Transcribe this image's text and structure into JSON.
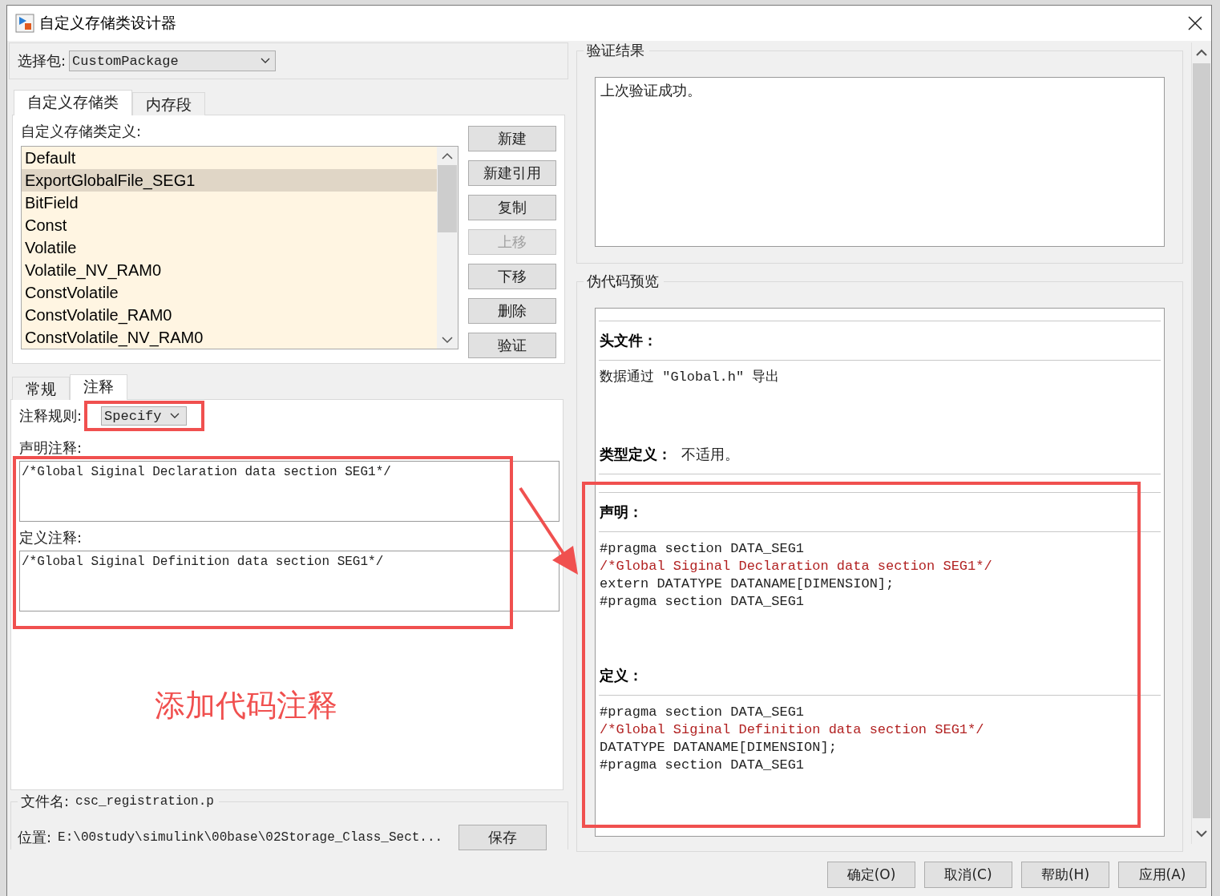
{
  "window": {
    "title": "自定义存储类设计器"
  },
  "package": {
    "label": "选择包:",
    "value": "CustomPackage"
  },
  "main_tabs": [
    {
      "label": "自定义存储类",
      "selected": true
    },
    {
      "label": "内存段",
      "selected": false
    }
  ],
  "definitions": {
    "label": "自定义存储类定义:",
    "items": [
      {
        "label": "Default",
        "selected": false
      },
      {
        "label": "ExportGlobalFile_SEG1",
        "selected": true
      },
      {
        "label": "BitField",
        "selected": false
      },
      {
        "label": "Const",
        "selected": false
      },
      {
        "label": "Volatile",
        "selected": false
      },
      {
        "label": "Volatile_NV_RAM0",
        "selected": false
      },
      {
        "label": "ConstVolatile",
        "selected": false
      },
      {
        "label": "ConstVolatile_RAM0",
        "selected": false
      },
      {
        "label": "ConstVolatile_NV_RAM0",
        "selected": false
      }
    ]
  },
  "list_buttons": [
    {
      "label": "新建",
      "disabled": false
    },
    {
      "label": "新建引用",
      "disabled": false
    },
    {
      "label": "复制",
      "disabled": false
    },
    {
      "label": "上移",
      "disabled": true
    },
    {
      "label": "下移",
      "disabled": false
    },
    {
      "label": "删除",
      "disabled": false
    },
    {
      "label": "验证",
      "disabled": false
    }
  ],
  "detail_tabs": [
    {
      "label": "常规",
      "selected": false
    },
    {
      "label": "注释",
      "selected": true
    }
  ],
  "comment_rule": {
    "label": "注释规则:",
    "value": "Specify"
  },
  "declaration_comment": {
    "label": "声明注释:",
    "value": "/*Global Siginal Declaration data section SEG1*/"
  },
  "definition_comment": {
    "label": "定义注释:",
    "value": "/*Global Siginal Definition data section SEG1*/"
  },
  "file": {
    "label": "文件名:",
    "value": "csc_registration.p"
  },
  "location": {
    "label": "位置:",
    "value": "E:\\00study\\simulink\\00base\\02Storage_Class_Sect..."
  },
  "save_button": "保存",
  "validation": {
    "title": "验证结果",
    "message": "上次验证成功。"
  },
  "preview": {
    "title": "伪代码预览",
    "sections": [
      {
        "heading": "头文件：",
        "lines": [
          {
            "kind": "code",
            "text": "数据通过 \"Global.h\" 导出"
          }
        ]
      },
      {
        "heading": "类型定义：",
        "note": "不适用。"
      },
      {
        "heading": "声明：",
        "lines": [
          {
            "kind": "code",
            "text": "#pragma section DATA_SEG1"
          },
          {
            "kind": "comment",
            "text": "/*Global Siginal Declaration data section SEG1*/"
          },
          {
            "kind": "code",
            "text": "extern DATATYPE DATANAME[DIMENSION];"
          },
          {
            "kind": "code",
            "text": "#pragma section DATA_SEG1"
          }
        ]
      },
      {
        "heading": "定义：",
        "lines": [
          {
            "kind": "code",
            "text": "#pragma section DATA_SEG1"
          },
          {
            "kind": "comment",
            "text": "/*Global Siginal Definition data section SEG1*/"
          },
          {
            "kind": "code",
            "text": "DATATYPE DATANAME[DIMENSION];"
          },
          {
            "kind": "code",
            "text": "#pragma section DATA_SEG1"
          }
        ]
      }
    ]
  },
  "buttons": [
    "确定(O)",
    "取消(C)",
    "帮助(H)",
    "应用(A)"
  ],
  "annotation": {
    "text": "添加代码注释"
  }
}
